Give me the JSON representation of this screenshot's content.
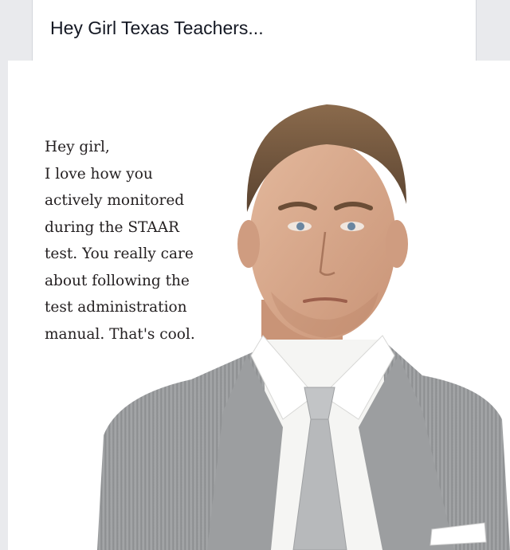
{
  "post": {
    "title": "Hey Girl Texas Teachers..."
  },
  "meme": {
    "lines": [
      "Hey girl,",
      "I love how you",
      "actively monitored",
      "during the STAAR",
      "test.  You really care",
      "about following the",
      "test administration",
      "manual.  That's cool."
    ]
  },
  "colors": {
    "page_background": "#e9eaed",
    "card_background": "#ffffff",
    "title_text": "#141823",
    "quote_text": "#231f20",
    "suit_gray": "#9a9c9e",
    "tie_gray": "#b7b9bb"
  }
}
